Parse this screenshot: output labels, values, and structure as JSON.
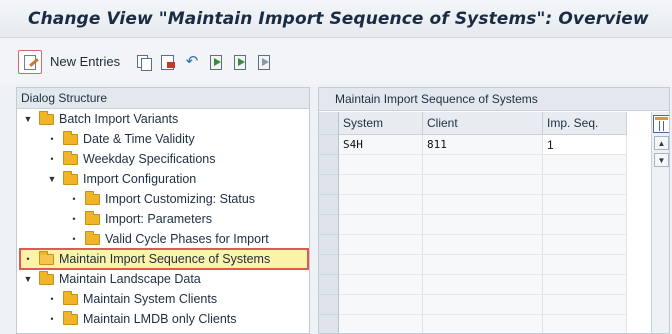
{
  "title": "Change View \"Maintain Import Sequence of Systems\": Overview",
  "toolbar": {
    "new_entries_label": "New Entries",
    "icons": [
      "new-entries-icon",
      "copy-icon",
      "delete-icon",
      "undo-icon",
      "select-all-icon",
      "select-block-icon",
      "deselect-all-icon"
    ]
  },
  "dialog_structure": {
    "header": "Dialog Structure",
    "items": [
      {
        "label": "Batch Import Variants",
        "level": 0,
        "expanded": true
      },
      {
        "label": "Date & Time Validity",
        "level": 1
      },
      {
        "label": "Weekday Specifications",
        "level": 1
      },
      {
        "label": "Import Configuration",
        "level": 1,
        "expanded": true
      },
      {
        "label": "Import Customizing: Status",
        "level": 2
      },
      {
        "label": "Import: Parameters",
        "level": 2
      },
      {
        "label": "Valid Cycle Phases for Import",
        "level": 2
      },
      {
        "label": "Maintain Import Sequence of Systems",
        "level": 0,
        "selected": true
      },
      {
        "label": "Maintain Landscape Data",
        "level": 0,
        "expanded": true
      },
      {
        "label": "Maintain System Clients",
        "level": 1
      },
      {
        "label": "Maintain LMDB only Clients",
        "level": 1
      }
    ]
  },
  "table": {
    "title": "Maintain Import Sequence of Systems",
    "columns": [
      "System",
      "Client",
      "Imp. Seq."
    ],
    "rows": [
      [
        "S4H",
        "811",
        "1"
      ]
    ]
  },
  "colors": {
    "selection_highlight": "#fbf3a8",
    "selection_border": "#e05a50",
    "folder": "#f0b429"
  }
}
